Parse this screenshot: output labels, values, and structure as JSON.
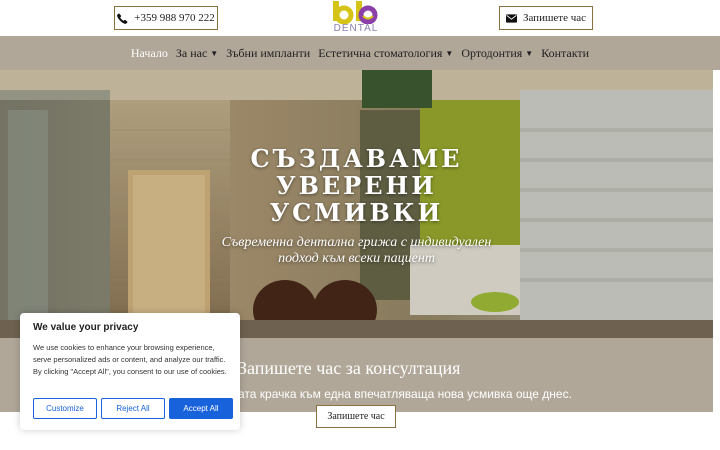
{
  "header": {
    "phone": "+359 988 970 222",
    "book_label": "Запишете час",
    "logo_text": "DENTAL"
  },
  "nav": {
    "items": [
      {
        "label": "Начало",
        "has_dropdown": false,
        "active": true
      },
      {
        "label": "За нас",
        "has_dropdown": true
      },
      {
        "label": "Зъбни импланти",
        "has_dropdown": false
      },
      {
        "label": "Естетична стоматология",
        "has_dropdown": true
      },
      {
        "label": "Ортодонтия",
        "has_dropdown": true
      },
      {
        "label": "Контакти",
        "has_dropdown": false
      }
    ]
  },
  "hero": {
    "title_lines": [
      "СЪЗДАВАМЕ",
      "УВЕРЕНИ",
      "УСМИВКИ"
    ],
    "subtitle_lines": [
      "Съвременна дентална грижа с индивидуален",
      "подход към всеки пациент"
    ]
  },
  "cta": {
    "title": "Запишете час за консултация",
    "text": "ата крачка към една впечатляваща нова усмивка още днес.",
    "button": "Запишете час"
  },
  "cookie": {
    "title": "We value your privacy",
    "text": "We use cookies to enhance your browsing experience, serve personalized ads or content, and analyze our traffic. By clicking \"Accept All\", you consent to our use of cookies.",
    "customize": "Customize",
    "reject": "Reject All",
    "accept": "Accept All"
  },
  "colors": {
    "nav_bg": "#b0a799",
    "button_border": "#8a7240",
    "cookie_accent": "#1863dc",
    "logo_yellow": "#d6c318",
    "logo_purple": "#8b3fa8"
  }
}
